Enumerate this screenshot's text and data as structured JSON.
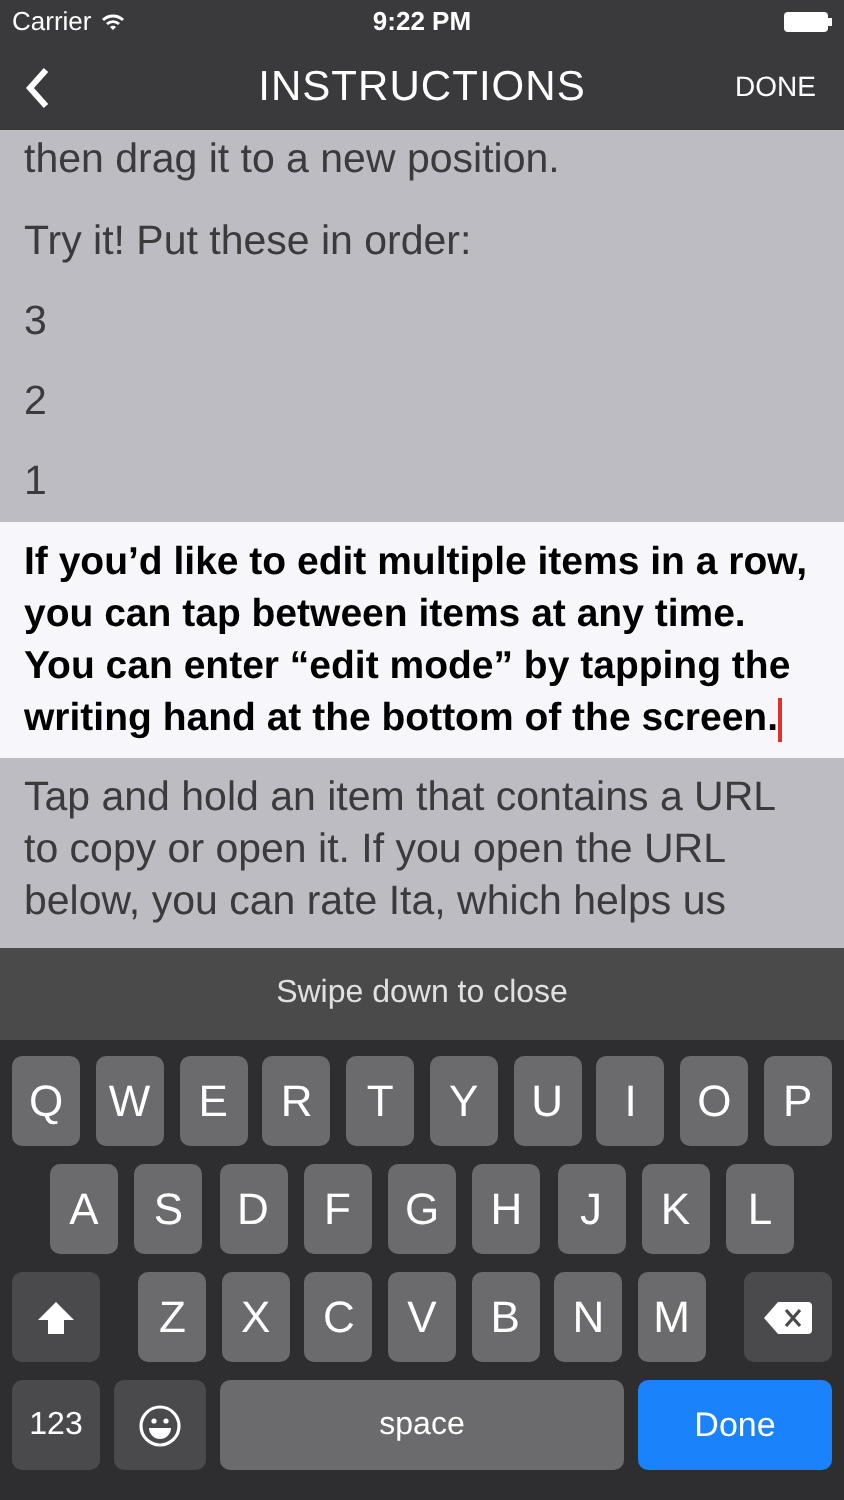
{
  "status_bar": {
    "carrier": "Carrier",
    "time": "9:22 PM"
  },
  "nav_bar": {
    "title": "INSTRUCTIONS",
    "right_button": "DONE"
  },
  "items": [
    {
      "text": "then drag it to a new position.",
      "selected": false
    },
    {
      "text": "Try it! Put these in order:",
      "selected": false
    },
    {
      "text": "3",
      "selected": false
    },
    {
      "text": "2",
      "selected": false
    },
    {
      "text": "1",
      "selected": false
    },
    {
      "text": "If you’d like to edit multiple items in a row, you can tap between items at any time. You can enter “edit mode” by tapping the writing hand at the bottom of the screen.",
      "selected": true
    },
    {
      "text": "Tap and hold an item that contains a URL to copy or open it. If you open the URL below, you can rate Ita, which helps us",
      "selected": false
    }
  ],
  "keyboard": {
    "hint": "Swipe down to close",
    "top_row": [
      {
        "kind": "letter",
        "label": "Q"
      },
      {
        "kind": "letter",
        "label": "W"
      },
      {
        "kind": "letter",
        "label": "E"
      },
      {
        "kind": "letter",
        "label": "R"
      },
      {
        "kind": "letter",
        "label": "T"
      },
      {
        "kind": "letter",
        "label": "Y"
      },
      {
        "kind": "letter",
        "label": "U"
      },
      {
        "kind": "letter",
        "label": "I"
      },
      {
        "kind": "letter",
        "label": "O"
      },
      {
        "kind": "letter",
        "label": "P"
      }
    ],
    "middle_row": [
      {
        "kind": "letter",
        "label": "A"
      },
      {
        "kind": "letter",
        "label": "S"
      },
      {
        "kind": "letter",
        "label": "D"
      },
      {
        "kind": "letter",
        "label": "F"
      },
      {
        "kind": "letter",
        "label": "G"
      },
      {
        "kind": "letter",
        "label": "H"
      },
      {
        "kind": "letter",
        "label": "J"
      },
      {
        "kind": "letter",
        "label": "K"
      },
      {
        "kind": "letter",
        "label": "L"
      }
    ],
    "lower_row": [
      {
        "kind": "shift"
      },
      {
        "kind": "letter",
        "label": "Z"
      },
      {
        "kind": "letter",
        "label": "X"
      },
      {
        "kind": "letter",
        "label": "C"
      },
      {
        "kind": "letter",
        "label": "V"
      },
      {
        "kind": "letter",
        "label": "B"
      },
      {
        "kind": "letter",
        "label": "N"
      },
      {
        "kind": "letter",
        "label": "M"
      },
      {
        "kind": "delete"
      }
    ],
    "function_row": [
      {
        "kind": "numbers",
        "label": "123"
      },
      {
        "kind": "emoji"
      },
      {
        "kind": "space",
        "label": "space"
      },
      {
        "kind": "done",
        "label": "Done"
      }
    ]
  }
}
